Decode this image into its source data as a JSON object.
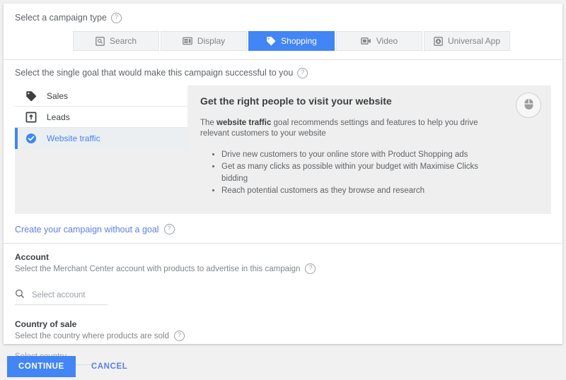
{
  "campaign_type": {
    "label": "Select a campaign type",
    "help_icon": "help-circle-icon",
    "tabs": [
      {
        "label": "Search",
        "icon": "search-square-icon",
        "active": false
      },
      {
        "label": "Display",
        "icon": "display-layout-icon",
        "active": false
      },
      {
        "label": "Shopping",
        "icon": "price-tag-icon",
        "active": true
      },
      {
        "label": "Video",
        "icon": "video-camera-icon",
        "active": false
      },
      {
        "label": "Universal App",
        "icon": "download-circle-icon",
        "active": false
      }
    ]
  },
  "goal": {
    "label": "Select the single goal that would make this campaign successful to you",
    "help_icon": "help-circle-icon",
    "items": [
      {
        "label": "Sales",
        "icon": "price-tag-icon",
        "selected": false
      },
      {
        "label": "Leads",
        "icon": "upload-box-icon",
        "selected": false
      },
      {
        "label": "Website traffic",
        "icon": "check-circle-icon",
        "selected": true
      }
    ],
    "detail": {
      "title": "Get the right people to visit your website",
      "desc_before": "The ",
      "desc_bold": "website traffic",
      "desc_after": " goal recommends settings and features to help you drive relevant customers to your website",
      "bullets": [
        "Drive new customers to your online store with Product Shopping ads",
        "Get as many clicks as possible within your budget with Maximise Clicks bidding",
        "Reach potential customers as they browse and research"
      ],
      "badge_icon": "computer-mouse-icon"
    },
    "no_goal_link": "Create your campaign without a goal"
  },
  "account": {
    "title": "Account",
    "subtitle": "Select the Merchant Center account with products to advertise in this campaign",
    "search_icon": "search-icon",
    "placeholder": "Select account"
  },
  "country": {
    "title": "Country of sale",
    "subtitle": "Select the country where products are sold",
    "placeholder": "Select country"
  },
  "footer": {
    "continue_label": "CONTINUE",
    "cancel_label": "CANCEL"
  },
  "colors": {
    "accent_blue": "#4285f4",
    "link_blue": "#5c7fe8",
    "panel_grey": "#efefef",
    "page_grey": "#f1f1f1"
  }
}
